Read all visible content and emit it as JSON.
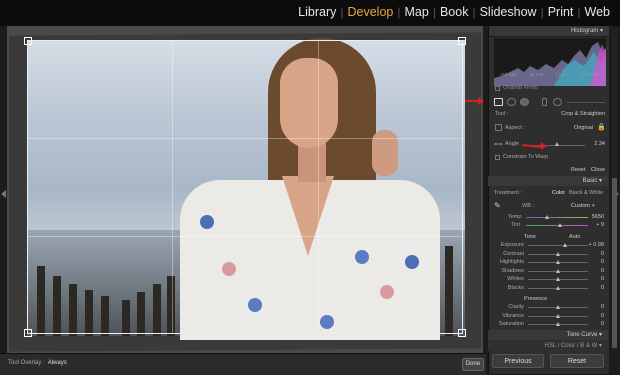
{
  "modules": [
    {
      "label": "Library",
      "active": false
    },
    {
      "label": "Develop",
      "active": true
    },
    {
      "label": "Map",
      "active": false
    },
    {
      "label": "Book",
      "active": false
    },
    {
      "label": "Slideshow",
      "active": false
    },
    {
      "label": "Print",
      "active": false
    },
    {
      "label": "Web",
      "active": false
    }
  ],
  "module_separator": "|",
  "colors": {
    "active_module": "#e8a843",
    "annotation_arrow": "#d81f1f"
  },
  "histogram": {
    "title": "Histogram",
    "stats": [
      "ISO 100",
      "24 mm",
      "f / 8.0",
      "1/125 sec"
    ],
    "original_photo_label": "Original Photo"
  },
  "crop_panel": {
    "tool_label": "Tool :",
    "tool_value": "Crop & Straighten",
    "aspect_label": "Aspect :",
    "aspect_value": "Original",
    "angle_label": "Angle",
    "angle_value": "2.34",
    "constrain_label": "Constrain To Warp",
    "reset_label": "Reset",
    "close_label": "Close"
  },
  "basic_panel": {
    "title": "Basic",
    "treatment_label": "Treatment :",
    "treatment_color": "Color",
    "treatment_bw": "Black & White",
    "wb_label": "WB :",
    "wb_value": "Custom",
    "temp_label": "Temp",
    "temp_value": "5650",
    "tint_label": "Tint",
    "tint_value": "+ 9",
    "tone_label": "Tone",
    "tone_auto": "Auto",
    "tone_rows": [
      {
        "label": "Exposure",
        "value": "+ 0.99",
        "fraction": 0.62
      },
      {
        "label": "Contrast",
        "value": "0",
        "fraction": 0.5
      },
      {
        "label": "Highlights",
        "value": "0",
        "fraction": 0.5
      },
      {
        "label": "Shadows",
        "value": "0",
        "fraction": 0.5
      },
      {
        "label": "Whites",
        "value": "0",
        "fraction": 0.5
      },
      {
        "label": "Blacks",
        "value": "0",
        "fraction": 0.5
      }
    ],
    "presence_label": "Presence",
    "presence_rows": [
      {
        "label": "Clarity",
        "value": "0",
        "fraction": 0.5
      },
      {
        "label": "Vibrance",
        "value": "0",
        "fraction": 0.5
      },
      {
        "label": "Saturation",
        "value": "0",
        "fraction": 0.5
      }
    ]
  },
  "tone_curve_title": "Tone Curve",
  "hsl_tabs": "HSL  /  Color  /  B & W",
  "bottom_bar": {
    "tool_overlay_label": "Tool Overlay :",
    "tool_overlay_value": "Always",
    "done_label": "Done"
  },
  "nav_buttons": {
    "previous": "Previous",
    "reset": "Reset"
  }
}
